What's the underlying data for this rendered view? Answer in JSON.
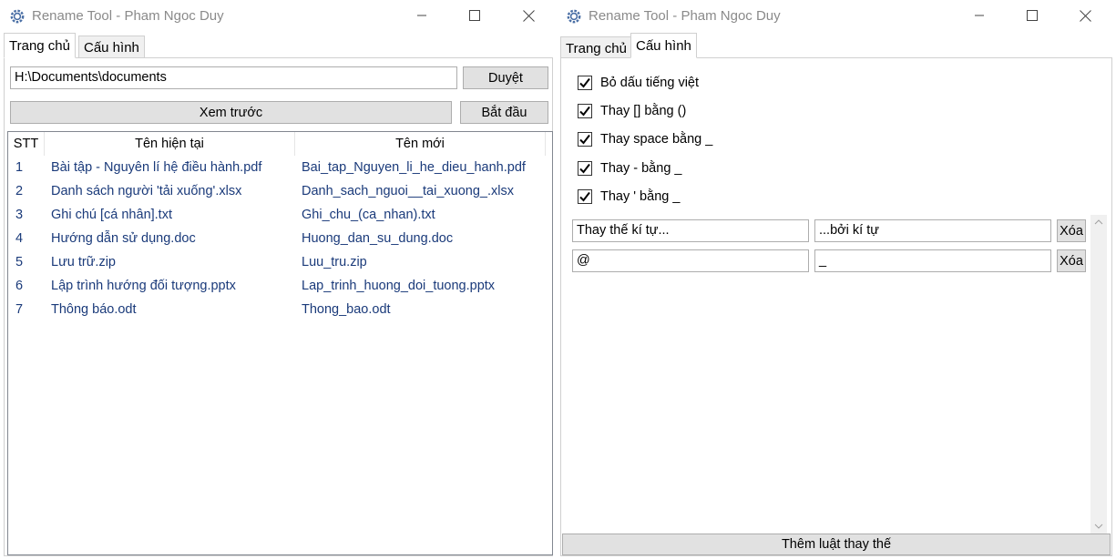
{
  "left_window": {
    "title": "Rename Tool - Pham Ngoc Duy",
    "tabs": [
      {
        "label": "Trang chủ",
        "active": true
      },
      {
        "label": "Cấu hình",
        "active": false
      }
    ],
    "path_input": {
      "value": "H:\\Documents\\documents"
    },
    "browse_label": "Duyệt",
    "preview_label": "Xem trước",
    "start_label": "Bắt đầu",
    "columns": [
      "STT",
      "Tên hiện tại",
      "Tên mới"
    ],
    "rows": [
      {
        "stt": "1",
        "current": "Bài tập - Nguyên lí hệ điều hành.pdf",
        "new": "Bai_tap_Nguyen_li_he_dieu_hanh.pdf"
      },
      {
        "stt": "2",
        "current": "Danh sách người 'tải xuống'.xlsx",
        "new": "Danh_sach_nguoi__tai_xuong_.xlsx"
      },
      {
        "stt": "3",
        "current": "Ghi chú [cá nhân].txt",
        "new": "Ghi_chu_(ca_nhan).txt"
      },
      {
        "stt": "4",
        "current": "Hướng dẫn sử dụng.doc",
        "new": "Huong_dan_su_dung.doc"
      },
      {
        "stt": "5",
        "current": "Lưu trữ.zip",
        "new": "Luu_tru.zip"
      },
      {
        "stt": "6",
        "current": "Lập trình hướng đối tượng.pptx",
        "new": "Lap_trinh_huong_doi_tuong.pptx"
      },
      {
        "stt": "7",
        "current": "Thông báo.odt",
        "new": "Thong_bao.odt"
      }
    ]
  },
  "right_window": {
    "title": "Rename Tool - Pham Ngoc Duy",
    "tabs": [
      {
        "label": "Trang chủ",
        "active": false
      },
      {
        "label": "Cấu hình",
        "active": true
      }
    ],
    "options": [
      {
        "label": "Bỏ dấu tiếng việt",
        "checked": true
      },
      {
        "label": "Thay [] bằng ()",
        "checked": true
      },
      {
        "label": "Thay space bằng _",
        "checked": true
      },
      {
        "label": "Thay - bằng _",
        "checked": true
      },
      {
        "label": "Thay ' bằng _",
        "checked": true
      }
    ],
    "rules": [
      {
        "find": "Thay thế kí tự...",
        "replace": "...bởi kí tự",
        "delete_label": "Xóa"
      },
      {
        "find": "@",
        "replace": "_",
        "delete_label": "Xóa"
      }
    ],
    "add_rule_label": "Thêm luật thay thế"
  },
  "colors": {
    "list_text": "#1a3a7a",
    "button_bg": "#e1e1e1",
    "title_text": "#8a8a8a",
    "app_icon": "#4a6fa5"
  },
  "icons": {
    "app": "gear-icon",
    "minimize": "minimize-icon",
    "maximize": "maximize-icon",
    "close": "close-icon",
    "check": "checkmark-icon"
  }
}
